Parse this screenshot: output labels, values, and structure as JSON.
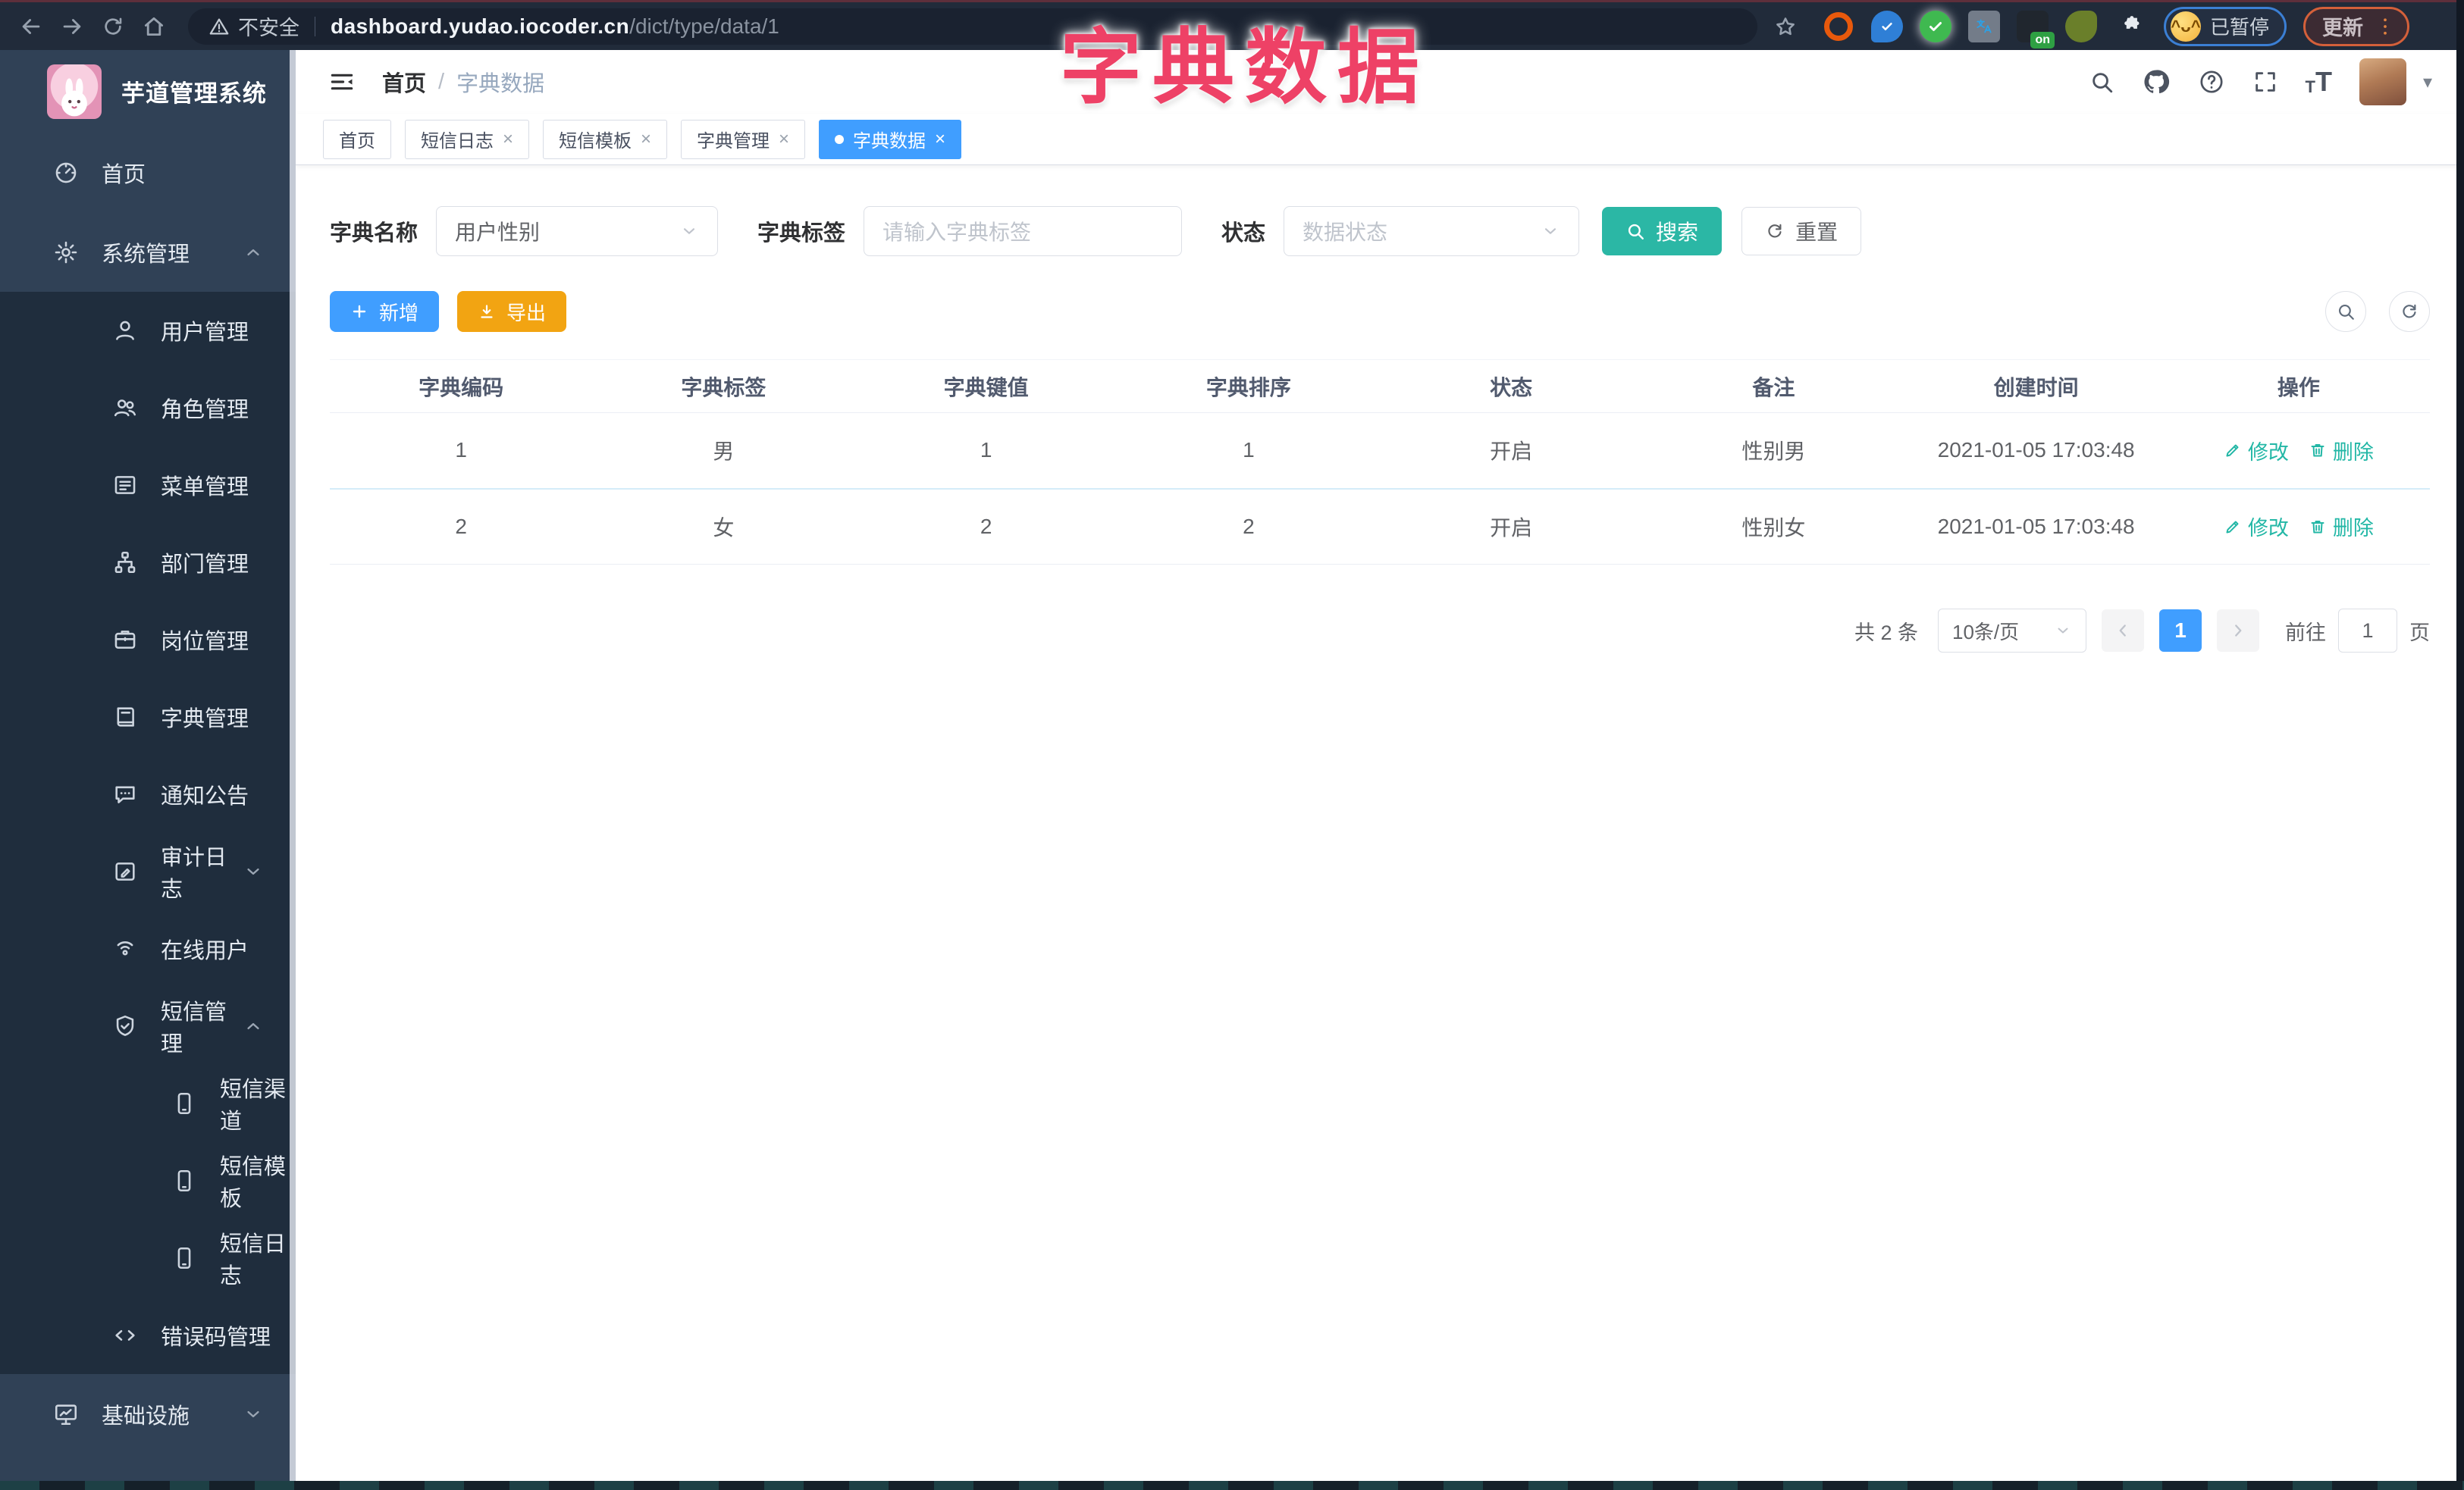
{
  "browser": {
    "security_label": "不安全",
    "url_host": "dashboard.yudao.iocoder.cn",
    "url_path": "/dict/type/data/1",
    "paused_chip": "已暂停",
    "update_button": "更新",
    "extension_icons": [
      "orange-ring-extension-icon",
      "blue-pin-extension-icon",
      "green-check-extension-icon",
      "gray-translate-extension-icon",
      "dark-on-badge-extension-icon",
      "green-sprout-extension-icon",
      "puzzle-extensions-icon"
    ],
    "on_badge": "on"
  },
  "overlay_title": "字典数据",
  "sidebar": {
    "logo_title": "芋道管理系统",
    "items": [
      {
        "id": "home",
        "label": "首页",
        "icon": "dashboard",
        "level": 1
      },
      {
        "id": "system-management",
        "label": "系统管理",
        "icon": "gear",
        "level": 1,
        "caret": "up"
      },
      {
        "id": "user-management",
        "label": "用户管理",
        "icon": "user",
        "level": 2
      },
      {
        "id": "role-management",
        "label": "角色管理",
        "icon": "users",
        "level": 2
      },
      {
        "id": "menu-management",
        "label": "菜单管理",
        "icon": "list",
        "level": 2
      },
      {
        "id": "dept-management",
        "label": "部门管理",
        "icon": "tree",
        "level": 2
      },
      {
        "id": "post-management",
        "label": "岗位管理",
        "icon": "badge",
        "level": 2
      },
      {
        "id": "dict-management",
        "label": "字典管理",
        "icon": "book",
        "level": 2
      },
      {
        "id": "notice",
        "label": "通知公告",
        "icon": "comment",
        "level": 2
      },
      {
        "id": "audit-log",
        "label": "审计日志",
        "icon": "editlog",
        "level": 2,
        "caret": "down"
      },
      {
        "id": "online-users",
        "label": "在线用户",
        "icon": "online",
        "level": 2
      },
      {
        "id": "sms-management",
        "label": "短信管理",
        "icon": "shield",
        "level": 2,
        "caret": "up"
      },
      {
        "id": "sms-channel",
        "label": "短信渠道",
        "icon": "mobile",
        "level": 3
      },
      {
        "id": "sms-template",
        "label": "短信模板",
        "icon": "mobile",
        "level": 3
      },
      {
        "id": "sms-log",
        "label": "短信日志",
        "icon": "mobile",
        "level": 3
      },
      {
        "id": "error-code",
        "label": "错误码管理",
        "icon": "code",
        "level": 2
      },
      {
        "id": "infrastructure",
        "label": "基础设施",
        "icon": "monitor",
        "level": 1,
        "caret": "down"
      }
    ]
  },
  "header": {
    "breadcrumb": [
      "首页",
      "字典数据"
    ]
  },
  "tabs": [
    {
      "id": "home",
      "label": "首页",
      "closable": false,
      "active": false
    },
    {
      "id": "sms-log",
      "label": "短信日志",
      "closable": true,
      "active": false
    },
    {
      "id": "sms-template",
      "label": "短信模板",
      "closable": true,
      "active": false
    },
    {
      "id": "dict-management",
      "label": "字典管理",
      "closable": true,
      "active": false
    },
    {
      "id": "dict-data",
      "label": "字典数据",
      "closable": true,
      "active": true
    }
  ],
  "filters": {
    "name_label": "字典名称",
    "name_value": "用户性别",
    "tag_label": "字典标签",
    "tag_placeholder": "请输入字典标签",
    "status_label": "状态",
    "status_placeholder": "数据状态",
    "search_label": "搜索",
    "reset_label": "重置"
  },
  "toolbar": {
    "add_label": "新增",
    "export_label": "导出"
  },
  "table": {
    "columns": [
      "字典编码",
      "字典标签",
      "字典键值",
      "字典排序",
      "状态",
      "备注",
      "创建时间",
      "操作"
    ],
    "rows": [
      {
        "values": [
          "1",
          "男",
          "1",
          "1",
          "开启",
          "性别男",
          "2021-01-05 17:03:48"
        ]
      },
      {
        "values": [
          "2",
          "女",
          "2",
          "2",
          "开启",
          "性别女",
          "2021-01-05 17:03:48"
        ]
      }
    ],
    "edit_label": "修改",
    "delete_label": "删除"
  },
  "pagination": {
    "total_text": "共 2 条",
    "page_size": "10条/页",
    "current_page": "1",
    "goto_label": "前往",
    "goto_value": "1",
    "page_unit": "页"
  },
  "colors": {
    "primary": "#409eff",
    "teal": "#2bb7a5",
    "warning": "#f2a412",
    "overlay_pink": "#ee4166",
    "sidebar_bg": "#304156",
    "submenu_bg": "#1f2d3d"
  }
}
